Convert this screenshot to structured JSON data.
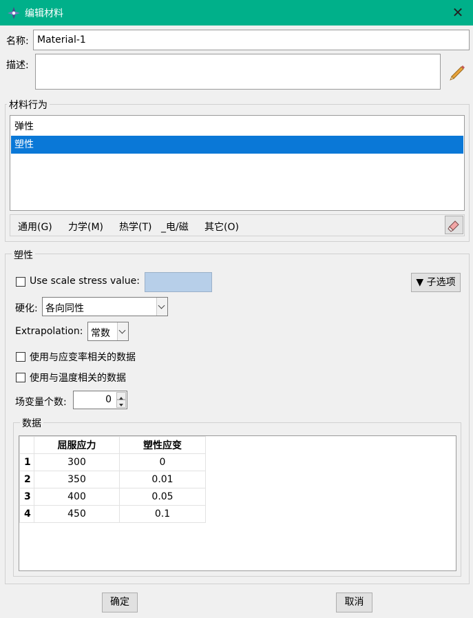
{
  "window": {
    "title": "编辑材料",
    "close_glyph": "✕"
  },
  "name_field": {
    "label": "名称:",
    "value": "Material-1"
  },
  "description": {
    "label": "描述:",
    "value": ""
  },
  "behaviors": {
    "legend": "材料行为",
    "items": [
      {
        "label": "弹性"
      },
      {
        "label": "塑性"
      }
    ],
    "selected_index": 1
  },
  "menu": {
    "items": [
      "通用(G)",
      "力学(M)",
      "热学(T)",
      "_电/磁",
      "其它(O)"
    ]
  },
  "plasticity": {
    "legend": "塑性",
    "scale_stress_label": "Use scale stress value:",
    "scale_stress_checked": false,
    "suboptions_label": "▼ 子选项",
    "hardening_label": "硬化:",
    "hardening_value": "各向同性",
    "extrapolation_label": "Extrapolation:",
    "extrapolation_value": "常数",
    "rate_dependent_label": "使用与应变率相关的数据",
    "temp_dependent_label": "使用与温度相关的数据",
    "field_vars_label": "场变量个数:",
    "field_vars_value": "0"
  },
  "data_table": {
    "legend": "数据",
    "columns": [
      "屈服应力",
      "塑性应变"
    ],
    "rows": [
      {
        "index": "1",
        "yield_stress": "300",
        "plastic_strain": "0"
      },
      {
        "index": "2",
        "yield_stress": "350",
        "plastic_strain": "0.01"
      },
      {
        "index": "3",
        "yield_stress": "400",
        "plastic_strain": "0.05"
      },
      {
        "index": "4",
        "yield_stress": "450",
        "plastic_strain": "0.1"
      }
    ]
  },
  "buttons": {
    "ok": "确定",
    "cancel": "取消"
  }
}
